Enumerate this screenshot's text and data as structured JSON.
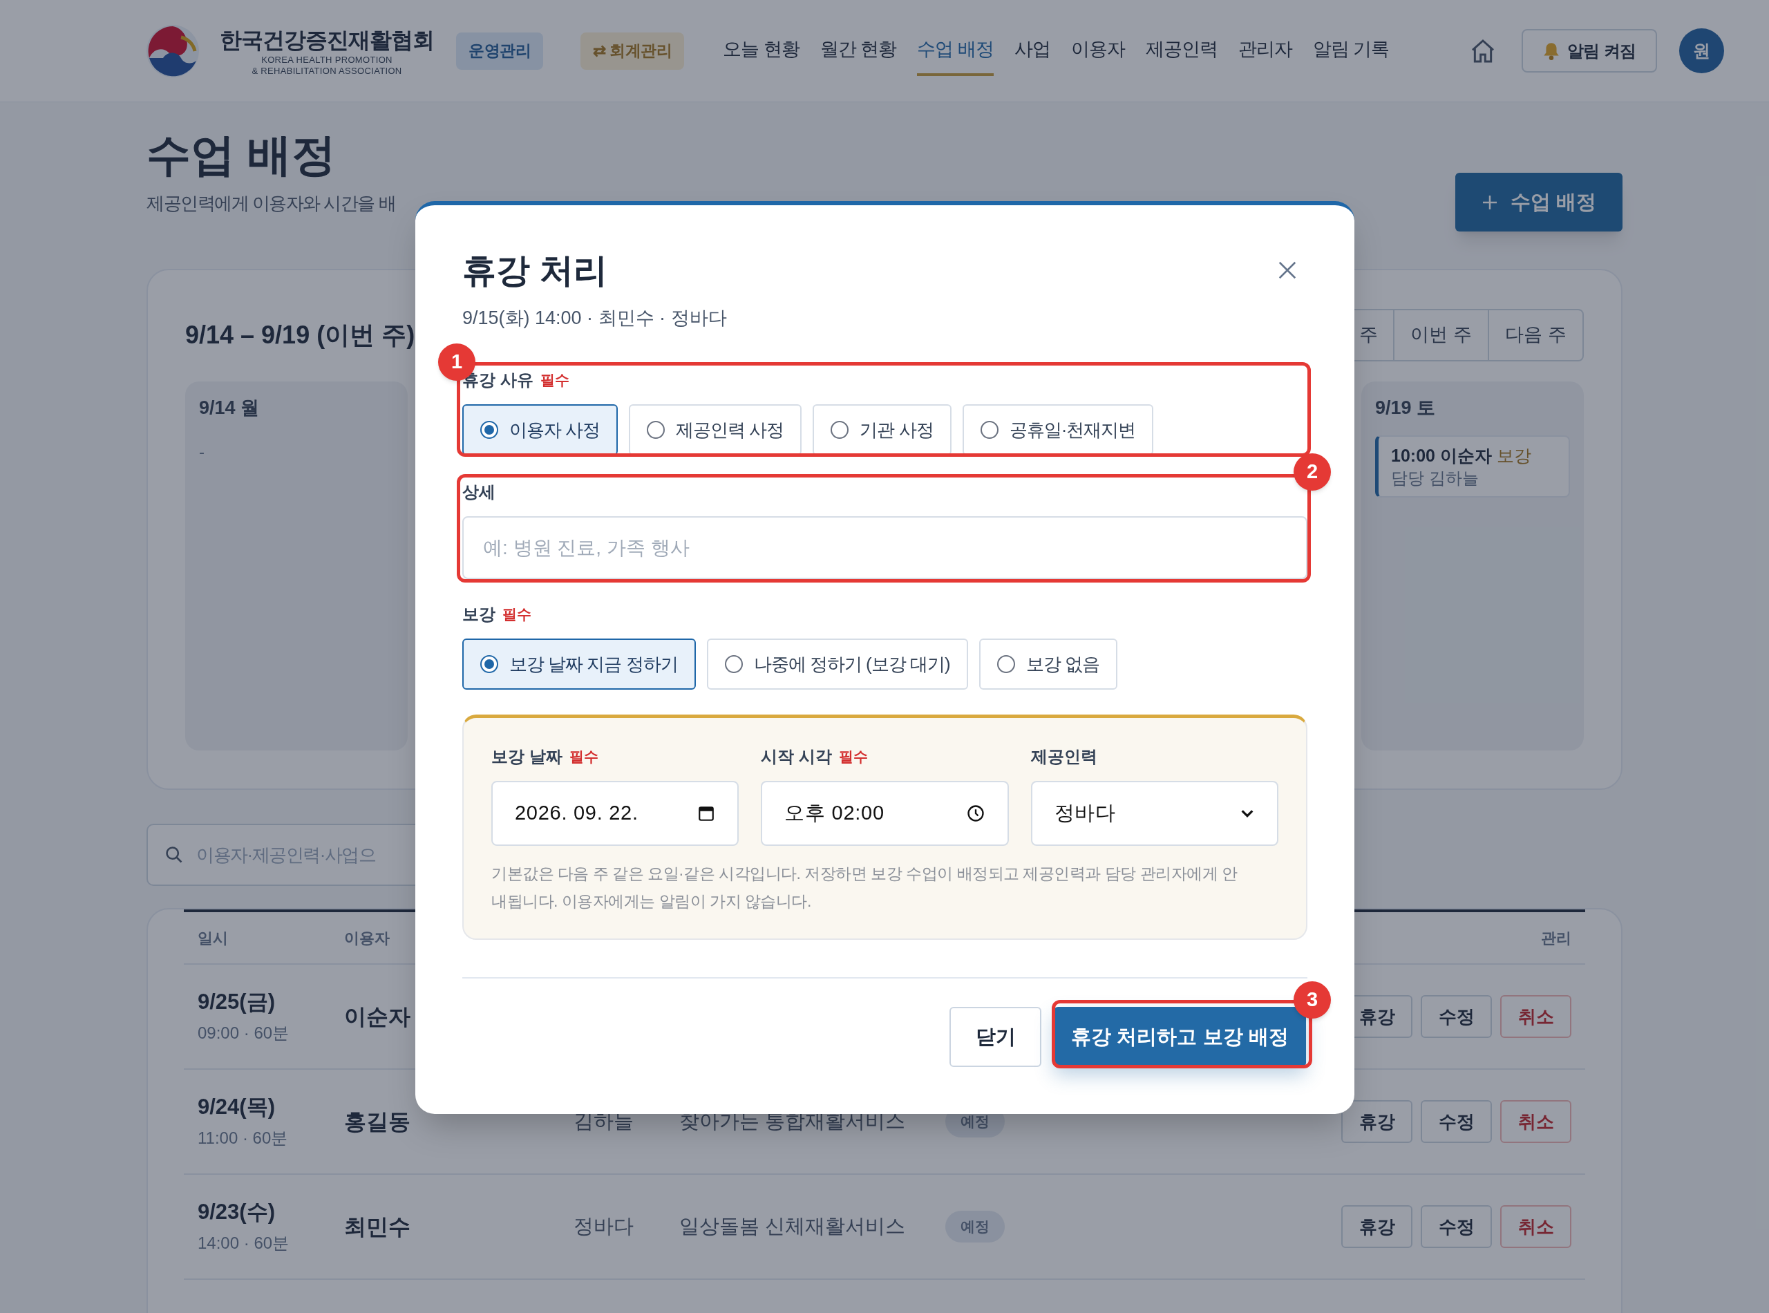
{
  "header": {
    "logo": {
      "name_ko": "한국건강증진재활협회",
      "name_en_1": "KOREA HEALTH PROMOTION",
      "name_en_2": "& REHABILITATION ASSOCIATION"
    },
    "badges": [
      {
        "label": "운영관리",
        "kind": "ops"
      },
      {
        "label": "⇄ 회계관리",
        "kind": "accounting"
      }
    ],
    "nav": [
      {
        "label": "오늘 현황",
        "selected": false
      },
      {
        "label": "월간 현황",
        "selected": false
      },
      {
        "label": "수업 배정",
        "selected": true
      },
      {
        "label": "사업",
        "selected": false
      },
      {
        "label": "이용자",
        "selected": false
      },
      {
        "label": "제공인력",
        "selected": false
      },
      {
        "label": "관리자",
        "selected": false
      },
      {
        "label": "알림 기록",
        "selected": false
      }
    ],
    "alert_button": "알림 켜짐",
    "avatar": "원"
  },
  "page": {
    "title": "수업 배정",
    "subtitle": "제공인력에게 이용자와 시간을 배",
    "add_button": "수업 배정"
  },
  "week": {
    "title": "9/14 – 9/19 (이번 주)",
    "nav": [
      {
        "label": "주"
      },
      {
        "label": "이번 주"
      },
      {
        "label": "다음 주"
      }
    ],
    "days": [
      {
        "label": "9/14 월",
        "empty": "-"
      },
      {
        "label": "9/19 토",
        "entries": [
          {
            "title": "10:00 이순자",
            "tag": "보강",
            "staff": "담당 김하늘"
          }
        ]
      }
    ]
  },
  "search": {
    "placeholder": "이용자·제공인력·사업으"
  },
  "table": {
    "columns": [
      "일시",
      "이용자",
      "관리"
    ],
    "rows": [
      {
        "date": "9/25(금)",
        "time": "09:00 · 60분",
        "client": "이순자",
        "actions": [
          "휴강",
          "수정",
          "취소"
        ]
      },
      {
        "date": "9/24(목)",
        "time": "11:00 · 60분",
        "client": "홍길동",
        "staff": "김하늘",
        "service": "찾아가는 통합재활서비스",
        "status": "예정",
        "actions": [
          "휴강",
          "수정",
          "취소"
        ]
      },
      {
        "date": "9/23(수)",
        "time": "14:00 · 60분",
        "client": "최민수",
        "staff": "정바다",
        "service": "일상돌봄 신체재활서비스",
        "status": "예정",
        "actions": [
          "휴강",
          "수정",
          "취소"
        ]
      }
    ]
  },
  "dialog": {
    "title": "휴강 처리",
    "subtitle": "9/15(화) 14:00 · 최민수 · 정바다",
    "reason": {
      "label": "휴강 사유",
      "required": "필수",
      "options": [
        {
          "label": "이용자 사정",
          "selected": true
        },
        {
          "label": "제공인력 사정",
          "selected": false
        },
        {
          "label": "기관 사정",
          "selected": false
        },
        {
          "label": "공휴일·천재지변",
          "selected": false
        }
      ]
    },
    "detail": {
      "label": "상세",
      "placeholder": "예: 병원 진료, 가족 행사"
    },
    "makeup": {
      "label": "보강",
      "required": "필수",
      "options": [
        {
          "label": "보강 날짜 지금 정하기",
          "selected": true
        },
        {
          "label": "나중에 정하기 (보강 대기)",
          "selected": false
        },
        {
          "label": "보강 없음",
          "selected": false
        }
      ]
    },
    "makeup_fields": [
      {
        "kind": "date",
        "label": "보강 날짜",
        "required": "필수",
        "value": "2026. 09. 22."
      },
      {
        "kind": "time",
        "label": "시작 시각",
        "required": "필수",
        "value": "오후 02:00"
      },
      {
        "kind": "select",
        "label": "제공인력",
        "value": "정바다"
      }
    ],
    "note": "기본값은 다음 주 같은 요일·같은 시각입니다. 저장하면 보강 수업이 배정되고 제공인력과 담당 관리자에게 안내됩니다. 이용자에게는 알림이 가지 않습니다.",
    "close_button": "닫기",
    "submit_button": "휴강 처리하고 보강 배정"
  },
  "callouts": [
    {
      "number": "1"
    },
    {
      "number": "2"
    },
    {
      "number": "3"
    }
  ]
}
